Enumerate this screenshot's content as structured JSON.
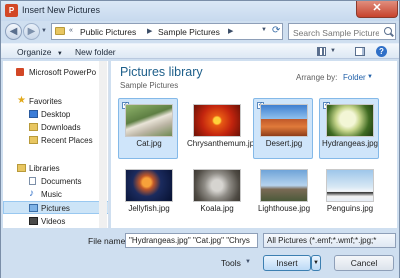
{
  "window": {
    "title": "Insert New Pictures"
  },
  "address": {
    "crumbs": [
      "Public Pictures",
      "Sample Pictures"
    ]
  },
  "search": {
    "placeholder": "Search Sample Pictures"
  },
  "toolbar": {
    "organize": "Organize",
    "new_folder": "New folder"
  },
  "nav": {
    "items": [
      {
        "label": "Microsoft PowerPo",
        "icon": "powerpoint-icon",
        "level": 0
      },
      {
        "label": "Favorites",
        "icon": "star-icon",
        "level": 0
      },
      {
        "label": "Desktop",
        "icon": "desktop-icon",
        "level": 1
      },
      {
        "label": "Downloads",
        "icon": "downloads-icon",
        "level": 1
      },
      {
        "label": "Recent Places",
        "icon": "recent-places-icon",
        "level": 1
      },
      {
        "label": "Libraries",
        "icon": "libraries-icon",
        "level": 0
      },
      {
        "label": "Documents",
        "icon": "documents-icon",
        "level": 1
      },
      {
        "label": "Music",
        "icon": "music-icon",
        "level": 1
      },
      {
        "label": "Pictures",
        "icon": "pictures-icon",
        "level": 1,
        "selected": true
      },
      {
        "label": "Videos",
        "icon": "videos-icon",
        "level": 1
      }
    ]
  },
  "content": {
    "title": "Pictures library",
    "subtitle": "Sample Pictures",
    "arrange_label": "Arrange by:",
    "arrange_value": "Folder",
    "items": [
      {
        "caption": "Cat.jpg",
        "selected": true
      },
      {
        "caption": "Chrysanthemum.jpg",
        "selected": false
      },
      {
        "caption": "Desert.jpg",
        "selected": true
      },
      {
        "caption": "Hydrangeas.jpg",
        "selected": true
      },
      {
        "caption": "Jellyfish.jpg",
        "selected": false
      },
      {
        "caption": "Koala.jpg",
        "selected": false
      },
      {
        "caption": "Lighthouse.jpg",
        "selected": false
      },
      {
        "caption": "Penguins.jpg",
        "selected": false
      }
    ]
  },
  "footer": {
    "file_name_label": "File name:",
    "file_name_value": "\"Hydrangeas.jpg\" \"Cat.jpg\" \"Chrys",
    "filter_value": "All Pictures (*.emf;*.wmf;*.jpg;*",
    "tools_label": "Tools",
    "insert_label": "Insert",
    "cancel_label": "Cancel"
  },
  "colors": {
    "accent": "#1e5f8a",
    "selection": "#cfe5fa",
    "close": "#c7432d"
  }
}
